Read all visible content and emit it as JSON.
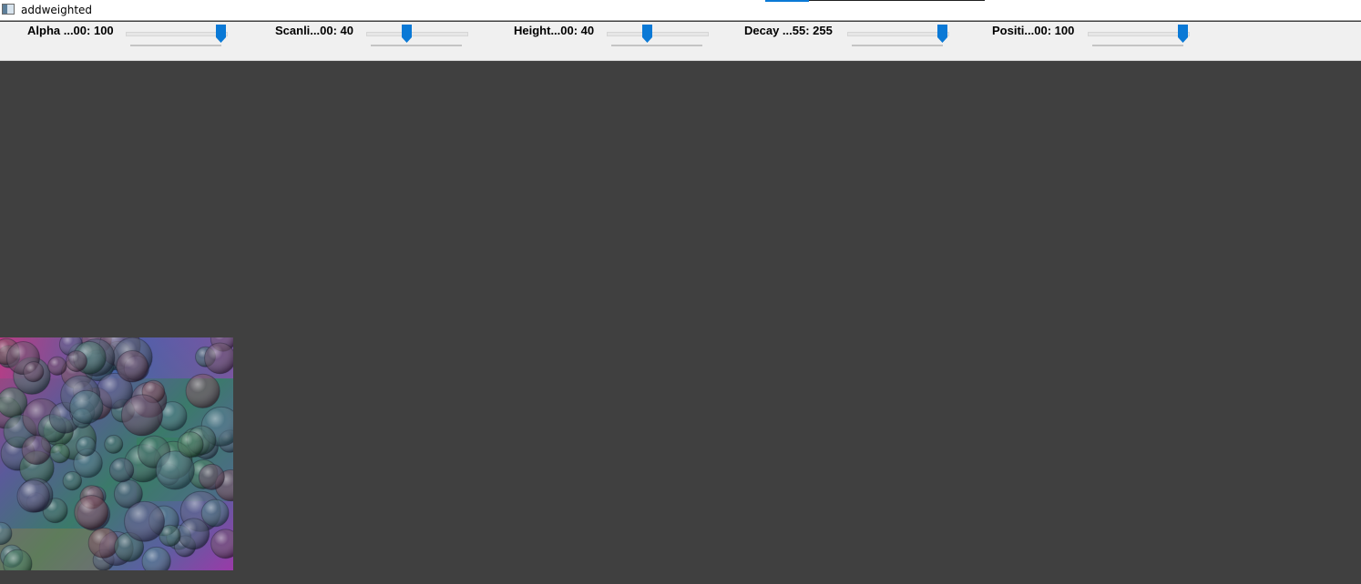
{
  "window": {
    "title": "addweighted",
    "icon": "window-app-icon"
  },
  "colors": {
    "accent": "#0a79d6",
    "toolbar_bg": "#f0f0f0",
    "canvas_bg": "#404040"
  },
  "trackbars": [
    {
      "label": "Alpha ...00: 100",
      "value": 100,
      "max": 100
    },
    {
      "label": "Scanli...00: 40",
      "value": 40,
      "max": 100
    },
    {
      "label": "Height...00: 40",
      "value": 40,
      "max": 100
    },
    {
      "label": "Decay ...55: 255",
      "value": 255,
      "max": 255
    },
    {
      "label": "Positi...00: 100",
      "value": 100,
      "max": 100
    }
  ],
  "canvas": {
    "image_name": "bubbles-image"
  }
}
